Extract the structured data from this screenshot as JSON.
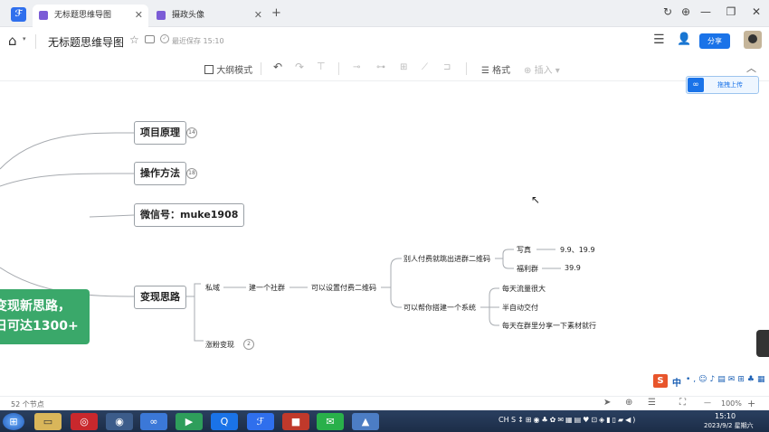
{
  "tabs": [
    {
      "label": "无标题思维导图"
    },
    {
      "label": "摄政头像"
    }
  ],
  "tab_close": "✕",
  "tab_add": "+",
  "window_controls": {
    "refresh": "↻",
    "pin": "⊕",
    "minimize": "—",
    "restore": "❐",
    "close": "✕"
  },
  "appbar": {
    "home_icon": "⌂",
    "doc_title": "无标题思维导图",
    "save_status": "最近保存 15:10",
    "share_label": "分享"
  },
  "toolbar": {
    "outline_label": "大纲模式",
    "format_label": "格式",
    "insert_label": "插入"
  },
  "upload_label": "拖拽上传",
  "mindmap": {
    "root_line1": "变现新思路，",
    "root_line2": "日可达1300+",
    "branches": [
      {
        "label": "项目原理",
        "badge": "14"
      },
      {
        "label": "操作方法",
        "badge": "18"
      },
      {
        "label": "微信号：muke1908"
      },
      {
        "label": "变现思路"
      }
    ],
    "private_domain": "私域",
    "build_community": "建一个社群",
    "pay_qr": "可以设置付费二维码",
    "others_pay": "别人付费就跳出进群二维码",
    "photo": "写真",
    "photo_price": "9.9、19.9",
    "welfare_group": "福利群",
    "welfare_price": "39.9",
    "help_build": "可以帮你搭建一个系统",
    "daily_traffic": "每天流量很大",
    "semi_auto": "半自动交付",
    "daily_share": "每天在群里分享一下素材就行",
    "fans_monetize": "涨粉变现",
    "fans_badge": "2"
  },
  "ime_label": "中",
  "statusbar": {
    "node_count": "52 个节点",
    "zoom": "100%",
    "zoom_minus": "—",
    "zoom_plus": "+"
  },
  "taskbar": {
    "time": "15:10",
    "date": "2023/9/2 星期六",
    "lang": "CH"
  },
  "colors": {
    "accent": "#1a73e8",
    "root_green": "#3aa86a",
    "taskbar": "#1f3150"
  }
}
